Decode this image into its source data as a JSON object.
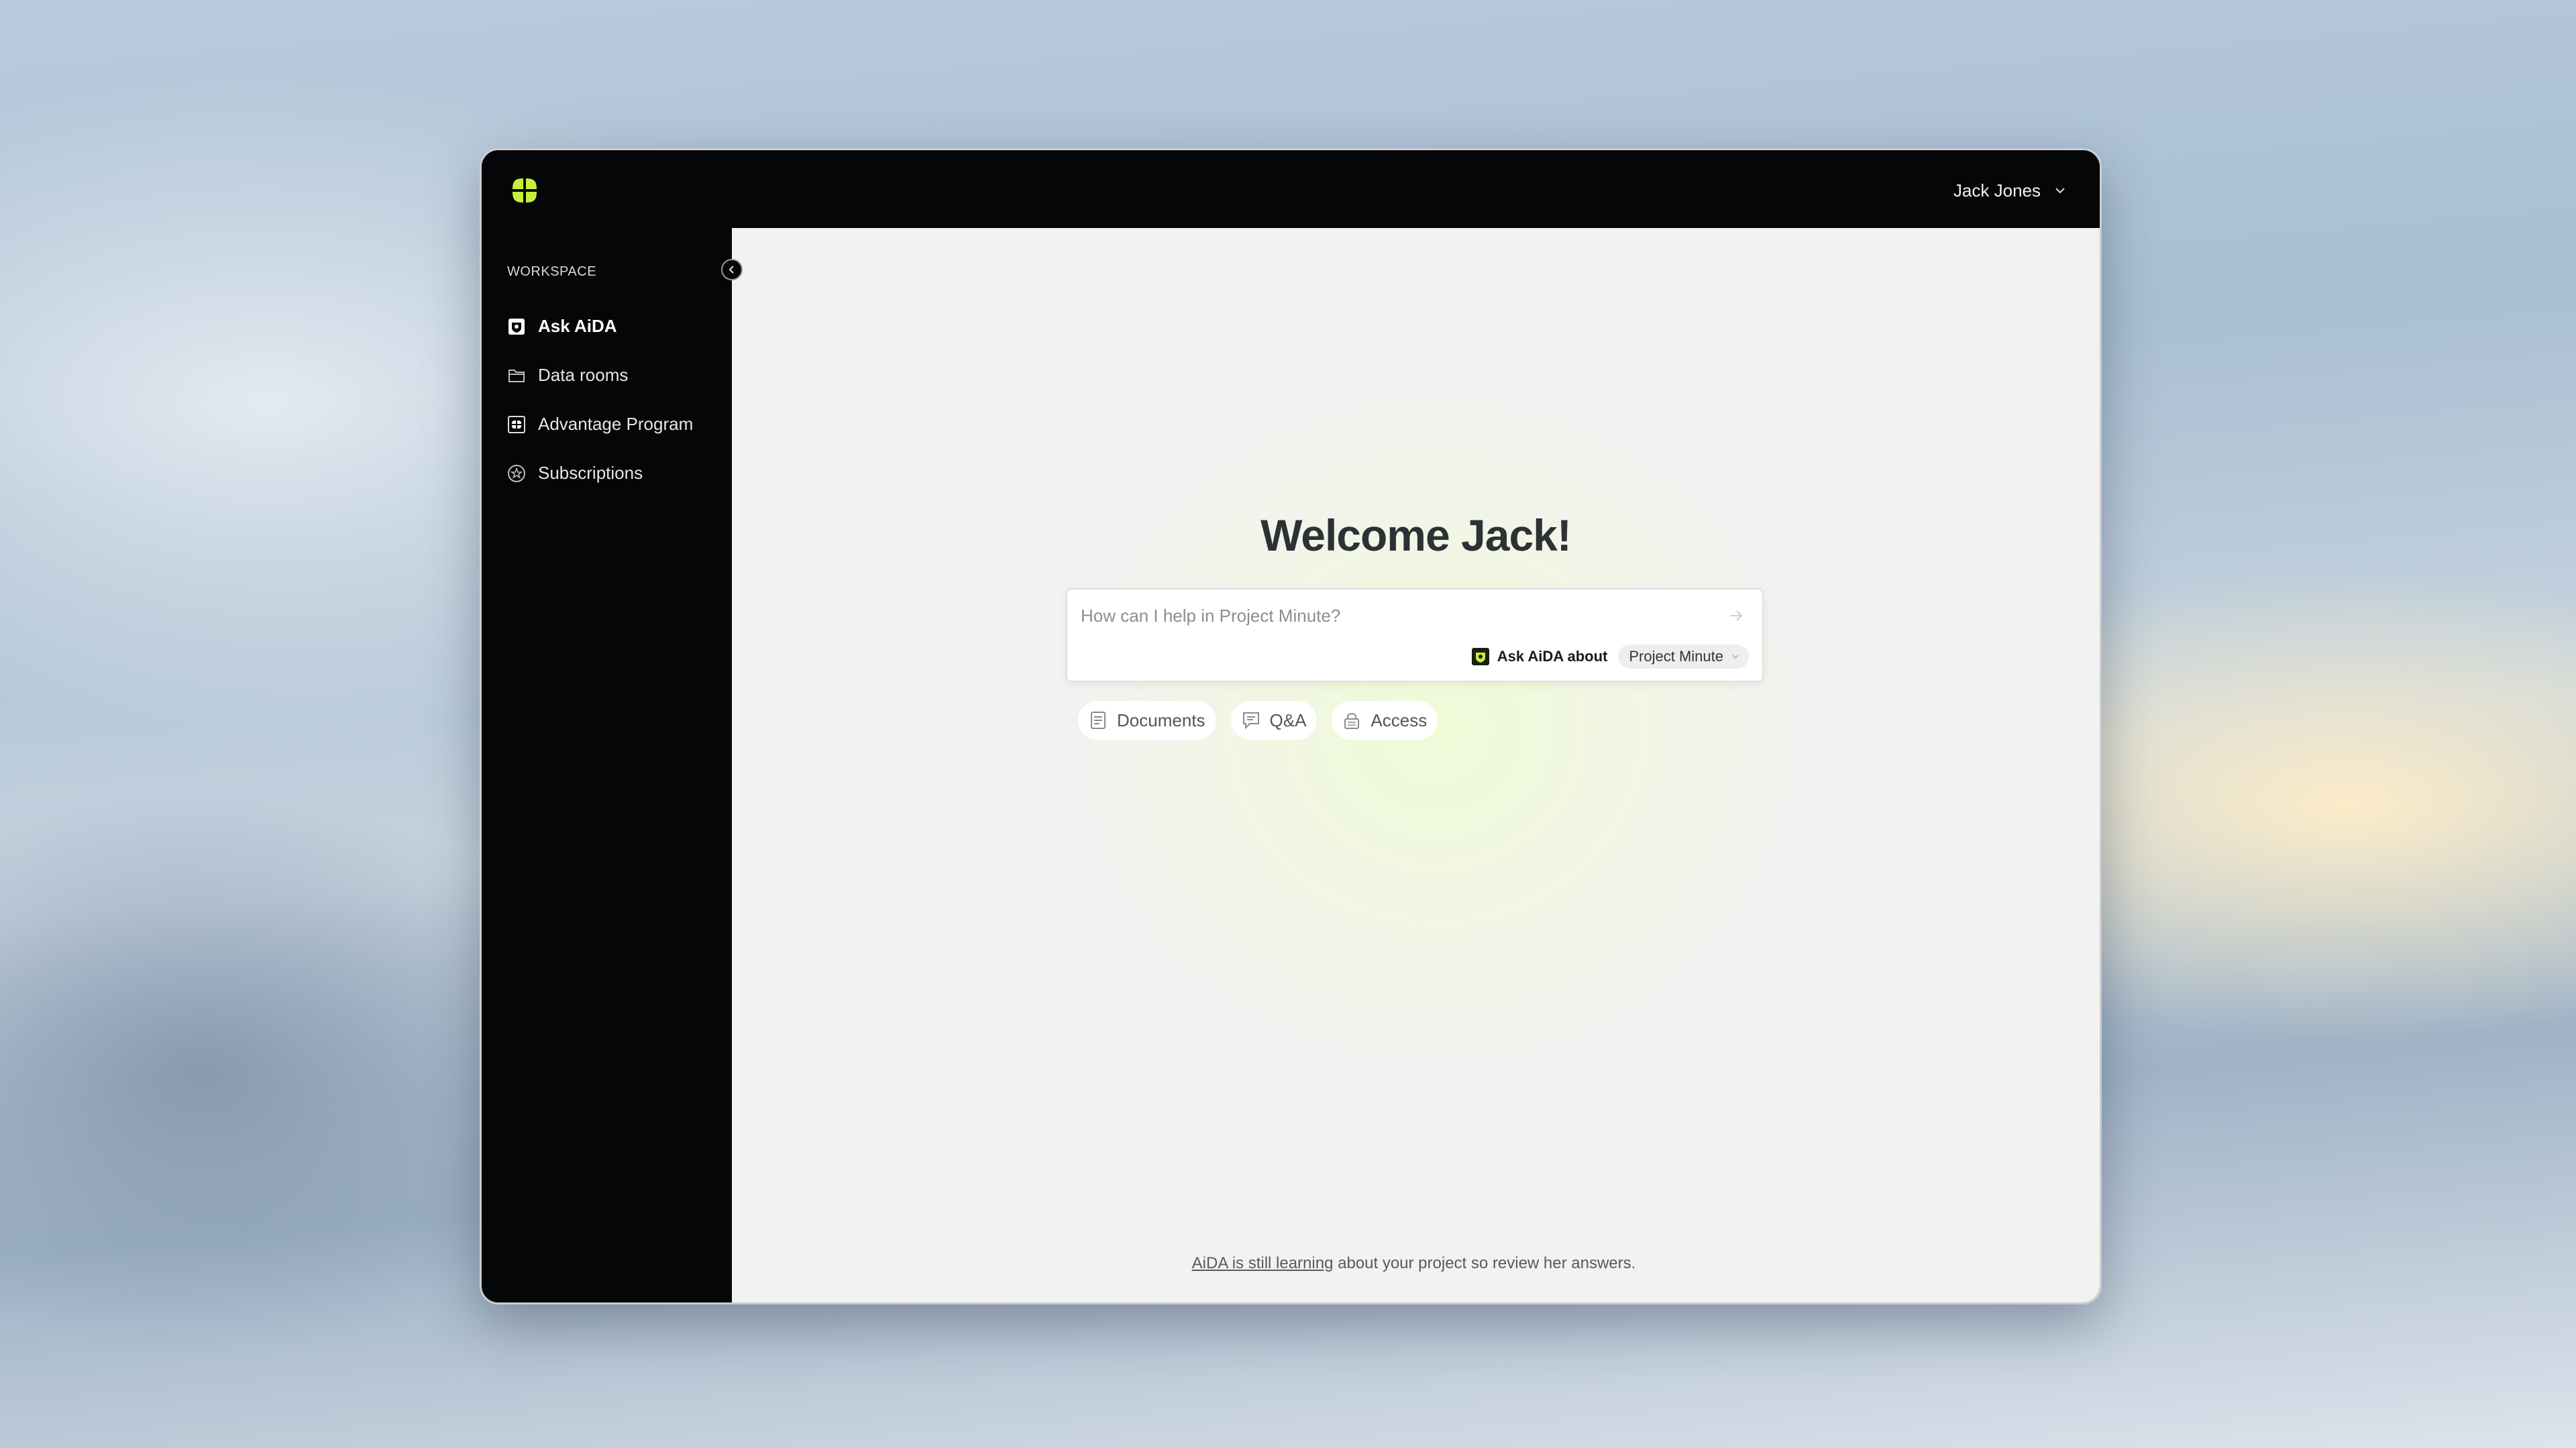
{
  "colors": {
    "accent": "#c6ef3b",
    "sidebar_bg": "#050608",
    "main_bg": "#f2f2f1"
  },
  "header": {
    "user_name": "Jack Jones",
    "logo_icon": "four-leaf-logo-icon",
    "user_menu_icon": "chevron-down-icon"
  },
  "sidebar": {
    "section_label": "WORKSPACE",
    "collapse_icon": "chevron-left-icon",
    "items": [
      {
        "label": "Ask AiDA",
        "icon": "shield-chat-icon",
        "active": true
      },
      {
        "label": "Data rooms",
        "icon": "folder-icon",
        "active": false
      },
      {
        "label": "Advantage Program",
        "icon": "grid-badge-icon",
        "active": false
      },
      {
        "label": "Subscriptions",
        "icon": "star-badge-icon",
        "active": false
      }
    ]
  },
  "main": {
    "welcome": "Welcome Jack!",
    "prompt": {
      "placeholder": "How can I help in Project Minute?",
      "send_icon": "arrow-right-icon",
      "ask_label": "Ask AiDA about",
      "project": "Project Minute",
      "project_icon": "chevron-down-icon"
    },
    "chips": [
      {
        "label": "Documents",
        "icon": "document-icon"
      },
      {
        "label": "Q&A",
        "icon": "chat-icon"
      },
      {
        "label": "Access",
        "icon": "lock-icon"
      }
    ],
    "footer": {
      "link": "AiDA is still learning",
      "text": " about your project so review her answers."
    }
  }
}
